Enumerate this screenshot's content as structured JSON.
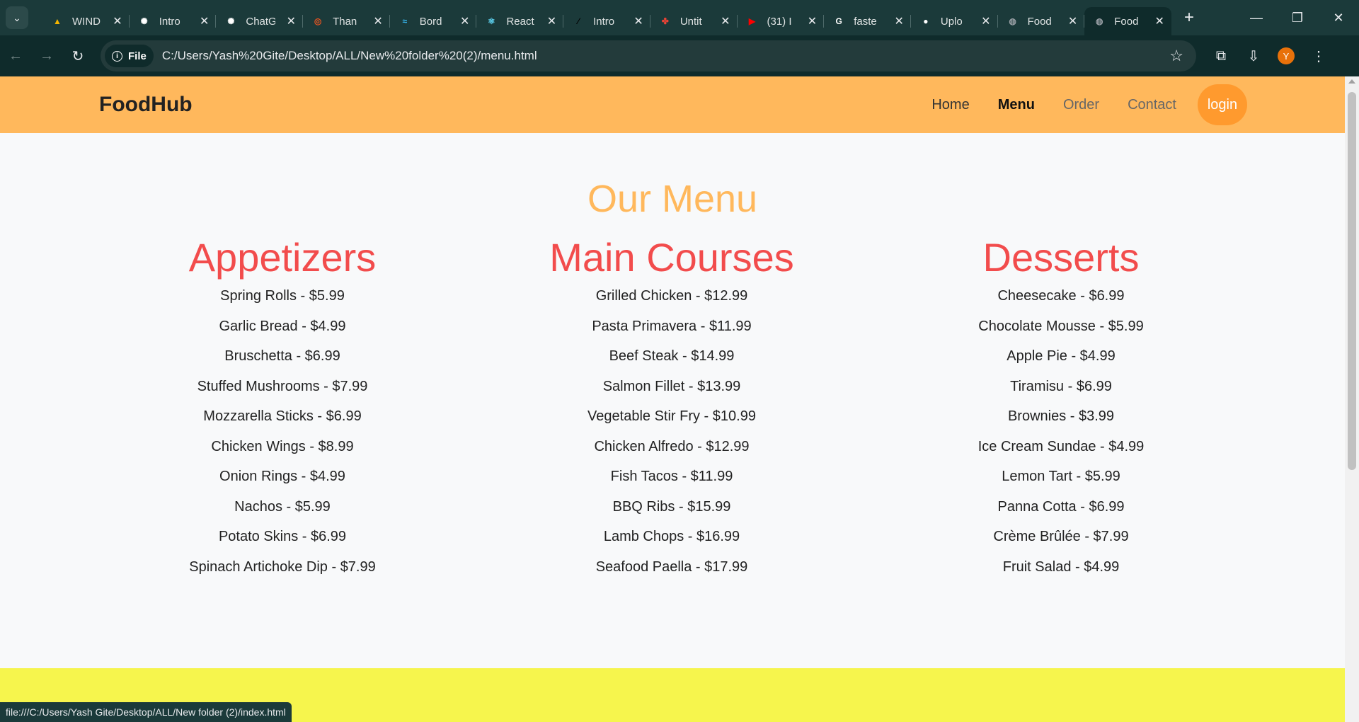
{
  "browser": {
    "tabs": [
      {
        "title": "WIND",
        "icon": "google-drive-icon",
        "color": "#f4b400"
      },
      {
        "title": "Intro",
        "icon": "chatgpt-icon",
        "color": "#ffffff"
      },
      {
        "title": "ChatG",
        "icon": "chatgpt-icon",
        "color": "#ffffff"
      },
      {
        "title": "Than",
        "icon": "ubuntu-icon",
        "color": "#e95420"
      },
      {
        "title": "Bord",
        "icon": "tailwind-icon",
        "color": "#38bdf8"
      },
      {
        "title": "React",
        "icon": "react-icon",
        "color": "#61dafb"
      },
      {
        "title": "Intro",
        "icon": "nextjs-icon",
        "color": "#000000"
      },
      {
        "title": "Untit",
        "icon": "pinwheel-icon",
        "color": "#ea4335"
      },
      {
        "title": "(31) I",
        "icon": "youtube-icon",
        "color": "#ff0000"
      },
      {
        "title": "faste",
        "icon": "google-icon",
        "color": "#ffffff"
      },
      {
        "title": "Uplo",
        "icon": "github-icon",
        "color": "#ffffff"
      },
      {
        "title": "Food",
        "icon": "globe-icon",
        "color": "#9aa0a6"
      },
      {
        "title": "Food",
        "icon": "globe-icon",
        "color": "#9aa0a6"
      }
    ],
    "site_chip": "File",
    "url": "C:/Users/Yash%20Gite/Desktop/ALL/New%20folder%20(2)/menu.html",
    "profile_initial": "Y",
    "status_url": "file:///C:/Users/Yash Gite/Desktop/ALL/New folder (2)/index.html"
  },
  "navbar": {
    "brand": "FoodHub",
    "links": [
      "Home",
      "Menu",
      "Order",
      "Contact"
    ],
    "login": "login"
  },
  "page": {
    "title": "Our Menu",
    "sections": [
      {
        "heading": "Appetizers",
        "items": [
          "Spring Rolls - $5.99",
          "Garlic Bread - $4.99",
          "Bruschetta - $6.99",
          "Stuffed Mushrooms - $7.99",
          "Mozzarella Sticks - $6.99",
          "Chicken Wings - $8.99",
          "Onion Rings - $4.99",
          "Nachos - $5.99",
          "Potato Skins - $6.99",
          "Spinach Artichoke Dip - $7.99"
        ]
      },
      {
        "heading": "Main Courses",
        "items": [
          "Grilled Chicken - $12.99",
          "Pasta Primavera - $11.99",
          "Beef Steak - $14.99",
          "Salmon Fillet - $13.99",
          "Vegetable Stir Fry - $10.99",
          "Chicken Alfredo - $12.99",
          "Fish Tacos - $11.99",
          "BBQ Ribs - $15.99",
          "Lamb Chops - $16.99",
          "Seafood Paella - $17.99"
        ]
      },
      {
        "heading": "Desserts",
        "items": [
          "Cheesecake - $6.99",
          "Chocolate Mousse - $5.99",
          "Apple Pie - $4.99",
          "Tiramisu - $6.99",
          "Brownies - $3.99",
          "Ice Cream Sundae - $4.99",
          "Lemon Tart - $5.99",
          "Panna Cotta - $6.99",
          "Crème Brûlée - $7.99",
          "Fruit Salad - $4.99"
        ]
      }
    ]
  },
  "colors": {
    "navbar_bg": "#ffb85c",
    "title_color": "#ffb85c",
    "section_heading": "#f24c4c",
    "login_bg": "#ff9a2e",
    "footer_band": "#f6f54d"
  }
}
